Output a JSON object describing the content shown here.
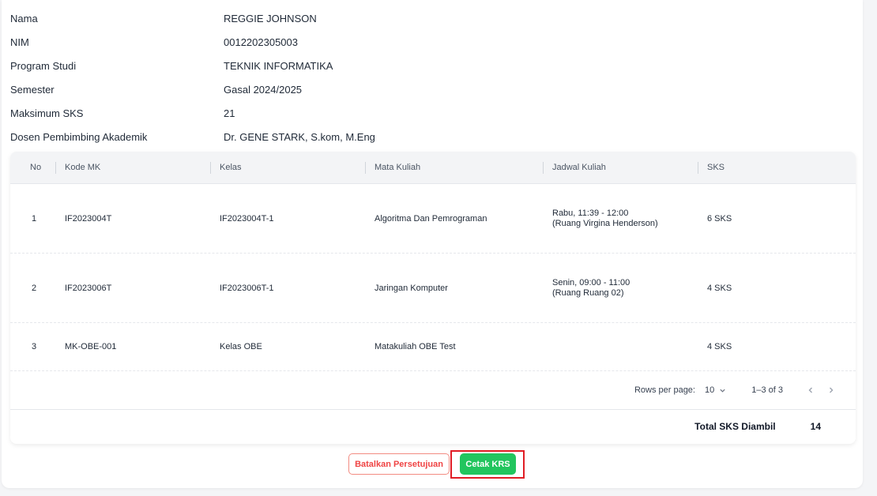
{
  "student": {
    "rows": [
      {
        "label": "Nama",
        "value": "REGGIE JOHNSON"
      },
      {
        "label": "NIM",
        "value": "0012202305003"
      },
      {
        "label": "Program Studi",
        "value": "TEKNIK INFORMATIKA"
      },
      {
        "label": "Semester",
        "value": "Gasal 2024/2025"
      },
      {
        "label": "Maksimum SKS",
        "value": "21"
      },
      {
        "label": "Dosen Pembimbing Akademik",
        "value": "Dr. GENE STARK, S.kom, M.Eng"
      }
    ]
  },
  "table": {
    "headers": {
      "no": "No",
      "kode": "Kode MK",
      "kelas": "Kelas",
      "mk": "Mata Kuliah",
      "jadwal": "Jadwal Kuliah",
      "sks": "SKS"
    },
    "rows": [
      {
        "no": "1",
        "kode": "IF2023004T",
        "kelas": "IF2023004T-1",
        "mk": "Algoritma Dan Pemrograman",
        "jadwal_line1": "Rabu, 11:39 - 12:00",
        "jadwal_line2": "(Ruang Virgina Henderson)",
        "sks": "6 SKS"
      },
      {
        "no": "2",
        "kode": "IF2023006T",
        "kelas": "IF2023006T-1",
        "mk": "Jaringan Komputer",
        "jadwal_line1": "Senin, 09:00 - 11:00",
        "jadwal_line2": "(Ruang Ruang 02)",
        "sks": "4 SKS"
      },
      {
        "no": "3",
        "kode": "MK-OBE-001",
        "kelas": "Kelas OBE",
        "mk": "Matakuliah OBE Test",
        "jadwal_line1": "",
        "jadwal_line2": "",
        "sks": "4 SKS"
      }
    ]
  },
  "pagination": {
    "rows_per_page_label": "Rows per page:",
    "rows_per_page_value": "10",
    "range": "1–3 of 3",
    "dropdown_icon": "chevron-down-icon",
    "prev_icon": "chevron-left-icon",
    "next_icon": "chevron-right-icon"
  },
  "total": {
    "label": "Total SKS Diambil",
    "value": "14"
  },
  "actions": {
    "cancel_label": "Batalkan Persetujuan",
    "print_label": "Cetak KRS"
  },
  "colors": {
    "accent_green": "#22c55e",
    "cancel_red": "#ef4444",
    "highlight_red": "#e11d25"
  }
}
